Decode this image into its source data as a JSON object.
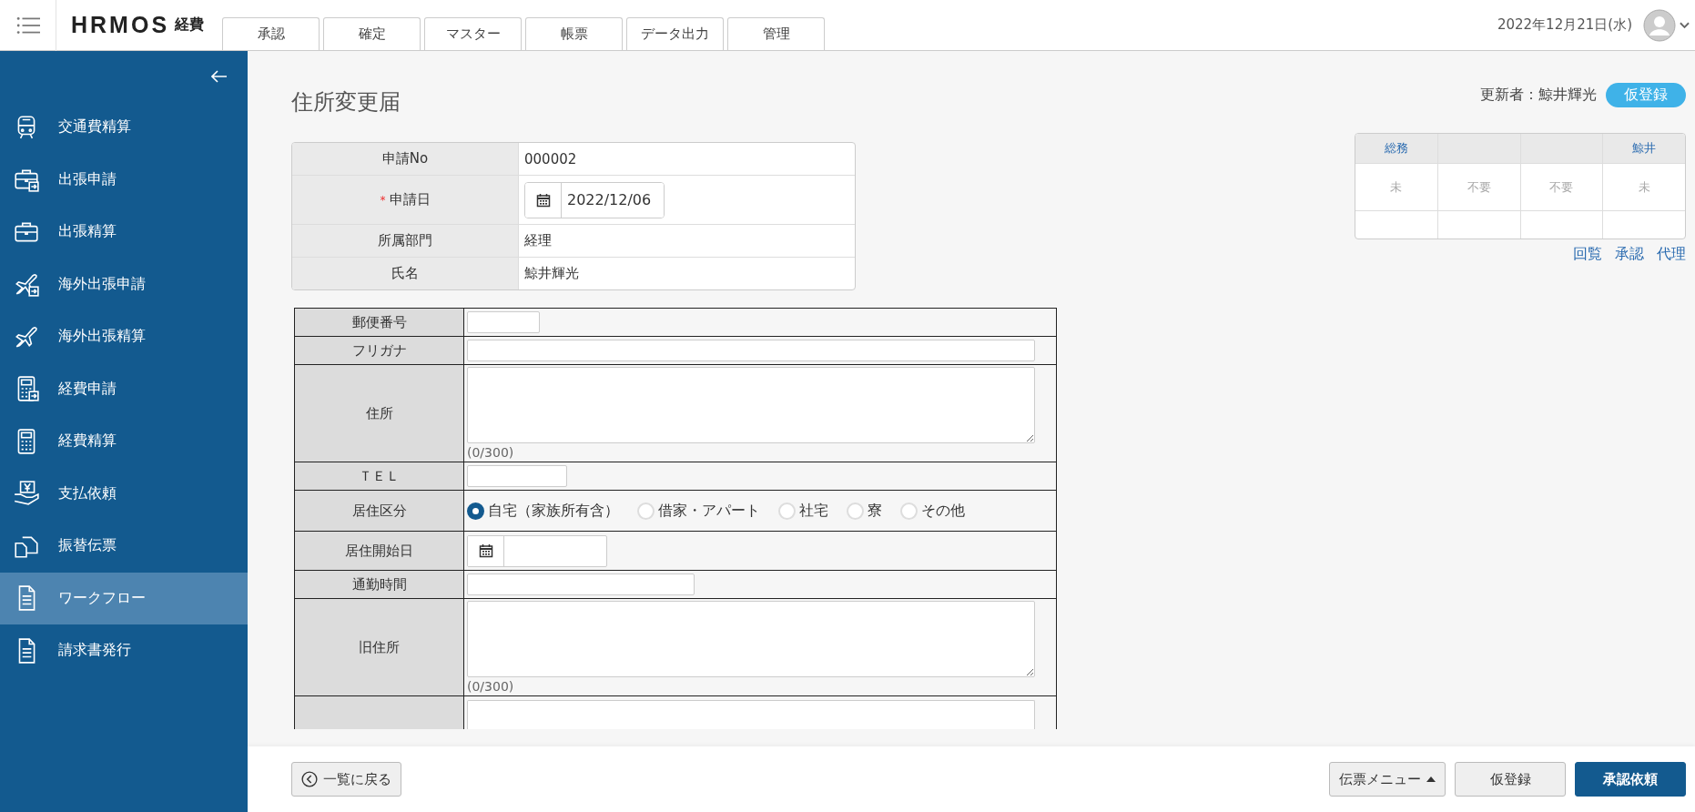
{
  "header": {
    "logo": "HRMOS",
    "logo_sub": "経費",
    "date": "2022年12月21日(水)"
  },
  "tabs": [
    {
      "label": "承認",
      "selected": false
    },
    {
      "label": "確定",
      "selected": false
    },
    {
      "label": "マスター",
      "selected": false
    },
    {
      "label": "帳票",
      "selected": false
    },
    {
      "label": "データ出力",
      "selected": false
    },
    {
      "label": "管理",
      "selected": false
    }
  ],
  "sidebar": {
    "items": [
      {
        "label": "交通費精算",
        "selected": false
      },
      {
        "label": "出張申請",
        "selected": false
      },
      {
        "label": "出張精算",
        "selected": false
      },
      {
        "label": "海外出張申請",
        "selected": false
      },
      {
        "label": "海外出張精算",
        "selected": false
      },
      {
        "label": "経費申請",
        "selected": false
      },
      {
        "label": "経費精算",
        "selected": false
      },
      {
        "label": "支払依頼",
        "selected": false
      },
      {
        "label": "振替伝票",
        "selected": false
      },
      {
        "label": "ワークフロー",
        "selected": true
      },
      {
        "label": "請求書発行",
        "selected": false
      }
    ]
  },
  "page": {
    "title": "住所変更届",
    "updater": "更新者：鯨井輝光",
    "status": "仮登録"
  },
  "info": [
    {
      "label": "申請No",
      "kind": "text",
      "value": "000002"
    },
    {
      "label": "申請日",
      "required_mark": "*",
      "kind": "date",
      "value": "2022/12/06"
    },
    {
      "label": "所属部門",
      "kind": "text",
      "value": "経理"
    },
    {
      "label": "氏名",
      "kind": "text",
      "value": "鯨井輝光"
    }
  ],
  "approval": {
    "columns": [
      {
        "header": "総務",
        "status": "未"
      },
      {
        "status": "不要"
      },
      {
        "status": "不要"
      },
      {
        "header": "鯨井",
        "status": "未"
      }
    ],
    "links": [
      "回覧",
      "承認",
      "代理"
    ]
  },
  "form": [
    {
      "label": "郵便番号",
      "kind": "postcode"
    },
    {
      "label": "フリガナ",
      "kind": "text"
    },
    {
      "label": "住所",
      "kind": "textarea",
      "counter": "(0/300)"
    },
    {
      "label": "ＴＥＬ",
      "kind": "tel"
    },
    {
      "label": "居住区分",
      "kind": "radio",
      "options": [
        {
          "label": "自宅（家族所有含）",
          "selected": true
        },
        {
          "label": "借家・アパート",
          "selected": false
        },
        {
          "label": "社宅",
          "selected": false
        },
        {
          "label": "寮",
          "selected": false
        },
        {
          "label": "その他",
          "selected": false
        }
      ]
    },
    {
      "label": "居住開始日",
      "kind": "date"
    },
    {
      "label": "通勤時間",
      "kind": "duration"
    },
    {
      "label": "旧住所",
      "kind": "textarea",
      "counter": "(0/300)"
    },
    {
      "kind": "textarea-cut"
    }
  ],
  "footer": {
    "back": "一覧に戻る",
    "menu": "伝票メニュー",
    "save": "仮登録",
    "submit": "承認依頼"
  }
}
